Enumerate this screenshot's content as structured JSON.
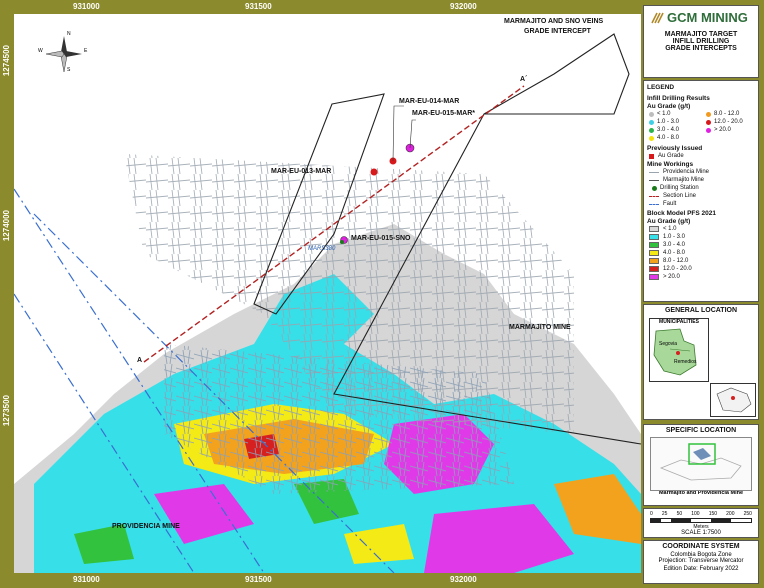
{
  "header": {
    "logo_text": "GCM MINING",
    "title_lines": [
      "MARMAJITO TARGET",
      "INFILL DRILLING",
      "GRADE INTERCEPTS"
    ]
  },
  "map": {
    "top_ticks": [
      "931000",
      "931500",
      "932000"
    ],
    "bottom_ticks": [
      "931000",
      "931500",
      "932000"
    ],
    "left_ticks": [
      "1274500",
      "1274000",
      "1273500"
    ],
    "right_ticks": [
      "1274500",
      "1274000",
      "1273500"
    ],
    "title_lines": [
      "MARMAJITO AND SNO VEINS",
      "GRADE INTERCEPT"
    ],
    "compass": {
      "n": "N",
      "s": "S",
      "e": "E",
      "w": "W"
    },
    "section_start": "A",
    "section_end": "A´",
    "mine_labels": {
      "marmajito": "MARMAJITO MINE",
      "providencia": "PROVIDENCIA MINE"
    },
    "drill_labels": {
      "mar014": "MAR-EU-014-MAR",
      "mar015": "MAR-EU-015-MAR*",
      "mar013": "MAR-EU-013-MAR",
      "sno015": "MAR-EU-015-SNO"
    },
    "station_label": "MARS380"
  },
  "legend": {
    "title": "LEGEND",
    "infill_title": "Infill Drilling Results",
    "au_grade": "Au Grade (g/t)",
    "infill_items": [
      {
        "label": "< 1.0",
        "color": "#bdbdbd"
      },
      {
        "label": "8.0 - 12.0",
        "color": "#f29a1f"
      },
      {
        "label": "1.0 - 3.0",
        "color": "#3fd0e8"
      },
      {
        "label": "12.0 - 20.0",
        "color": "#d7191c"
      },
      {
        "label": "3.0 - 4.0",
        "color": "#2bb24c"
      },
      {
        "label": "> 20.0",
        "color": "#e020e0"
      },
      {
        "label": "4.0 - 8.0",
        "color": "#f4e20a"
      }
    ],
    "prev_title": "Previously Issued",
    "prev_item": "Au Grade",
    "workings_title": "Mine Workings",
    "workings_items": [
      "Providencia Mine",
      "Marmajito Mine",
      "Drilling Station",
      "Section Line",
      "Fault"
    ],
    "block_title": "Block Model PFS 2021",
    "block_grade": "Au Grade (g/t)",
    "block_items": [
      {
        "label": "< 1.0",
        "color": "#d9d9d9"
      },
      {
        "label": "1.0 - 3.0",
        "color": "#38e0ea"
      },
      {
        "label": "3.0 - 4.0",
        "color": "#33c23d"
      },
      {
        "label": "4.0 - 8.0",
        "color": "#f4ea16"
      },
      {
        "label": "8.0 - 12.0",
        "color": "#f3a21d"
      },
      {
        "label": "12.0 - 20.0",
        "color": "#d62020"
      },
      {
        "label": "> 20.0",
        "color": "#e03ae8"
      }
    ]
  },
  "general": {
    "title": "GENERAL LOCATION",
    "municipalities": "MUNICIPALITIES",
    "segovia": "Segovia",
    "remedios": "Remedios"
  },
  "specific": {
    "title": "SPECIFIC LOCATION",
    "caption": "Marmajito and Providencia Mine"
  },
  "scale": {
    "ticks": [
      "0",
      "25",
      "50",
      "100",
      "150",
      "200",
      "250"
    ],
    "unit": "Meters",
    "ratio": "SCALE 1:7500"
  },
  "coord": {
    "title": "COORDINATE SYSTEM",
    "zone": "Colombia Bogota Zone",
    "projection": "Projection: Transverse Mercator",
    "edition": "Edition Date: February 2022"
  }
}
